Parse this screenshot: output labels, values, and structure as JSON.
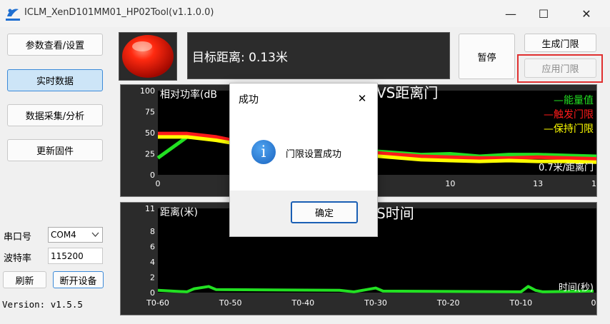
{
  "window": {
    "title": "ICLM_XenD101MM01_HP02Tool(v1.1.0.0)",
    "minimize": "—",
    "maximize": "☐",
    "close": "✕"
  },
  "sidebar": {
    "params_button": "参数查看/设置",
    "realtime_button": "实时数据",
    "collect_button": "数据采集/分析",
    "firmware_button": "更新固件",
    "port_label": "串口号",
    "port_value": "COM4",
    "baud_label": "波特率",
    "baud_value": "115200",
    "refresh_button": "刷新",
    "disconnect_button": "断开设备",
    "version": "Version: v1.5.5"
  },
  "header": {
    "target_distance": "目标距离: 0.13米",
    "pause_button": "暂停",
    "generate_threshold_button": "生成门限",
    "apply_threshold_button": "应用门限"
  },
  "colors": {
    "energy": "#22e022",
    "trigger": "#ff1a1a",
    "hold": "#ffff00",
    "highlight": "#e03030"
  },
  "chart_data": [
    {
      "type": "line",
      "title": "VS距离门",
      "ylabel": "相对功率(dB",
      "xlabel": "0.7米/距离门",
      "xlim": [
        0,
        15
      ],
      "ylim": [
        0,
        100
      ],
      "y_ticks": [
        "100",
        "75",
        "50",
        "25",
        "0"
      ],
      "x_ticks": [
        "0",
        "3",
        "10",
        "13",
        "15"
      ],
      "legend_position": "top-right",
      "series": [
        {
          "name": "能量值",
          "color": "#22e022",
          "x": [
            0,
            1,
            9,
            10,
            11,
            12,
            13,
            14,
            15
          ],
          "y": [
            20,
            45,
            24,
            25,
            22,
            24,
            24,
            23,
            22
          ]
        },
        {
          "name": "触发门限",
          "color": "#ff1a1a",
          "x": [
            0,
            1,
            2,
            3,
            9,
            10,
            11,
            12,
            13,
            14,
            15
          ],
          "y": [
            49,
            49,
            45,
            38,
            22,
            21,
            20,
            20,
            21,
            20,
            19
          ]
        },
        {
          "name": "保持门限",
          "color": "#ffff00",
          "x": [
            0,
            1,
            2,
            3,
            9,
            10,
            11,
            12,
            13,
            14,
            15
          ],
          "y": [
            45,
            45,
            41,
            35,
            18,
            17,
            16,
            17,
            16,
            16,
            15
          ]
        }
      ]
    },
    {
      "type": "line",
      "title": "S时间",
      "ylabel": "距离(米)",
      "xlabel": "时间(秒)",
      "ylim": [
        0,
        11
      ],
      "y_ticks": [
        "11",
        "8",
        "6",
        "4",
        "2",
        "0"
      ],
      "x_ticks": [
        "T0-60",
        "T0-50",
        "T0-40",
        "T0-30",
        "T0-20",
        "T0-10",
        "0"
      ],
      "series": [
        {
          "color": "#22e022",
          "x": [
            -60,
            -58,
            -56,
            -55,
            -53,
            -52,
            -35,
            -33,
            -30,
            -29,
            -10,
            -9,
            -8,
            -7,
            0
          ],
          "y": [
            0.3,
            0.2,
            0.1,
            0.5,
            0.8,
            0.4,
            0.3,
            0.1,
            0.6,
            0.2,
            0.1,
            0.8,
            0.3,
            0.1,
            0.2
          ]
        }
      ]
    }
  ],
  "dialog": {
    "title": "成功",
    "close": "✕",
    "icon": "info-icon",
    "icon_glyph": "i",
    "message": "门限设置成功",
    "ok_button": "确定"
  }
}
